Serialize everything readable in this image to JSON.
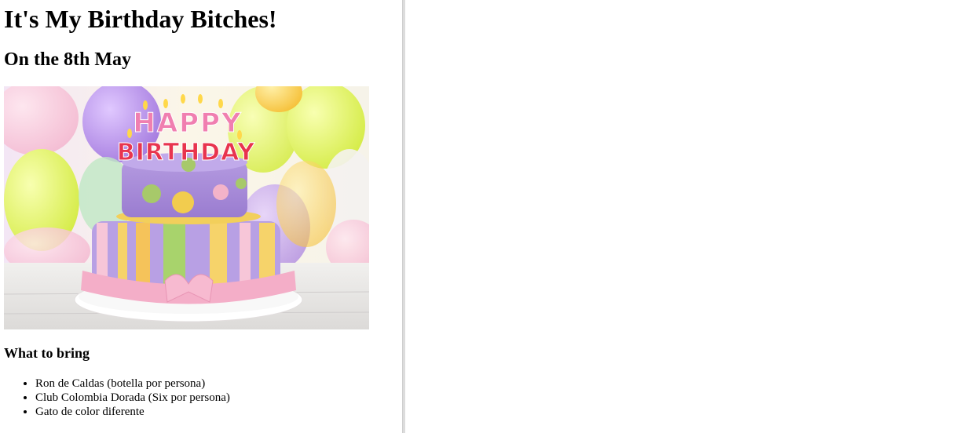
{
  "page": {
    "title": "It's My Birthday Bitches!",
    "date": "On the 8th May",
    "image": {
      "alt": "Happy Birthday cake",
      "cake_text_top": "HAPPY",
      "cake_text_bottom": "BIRTHDAY"
    },
    "bring_heading": "What to bring",
    "bring_items": [
      "Ron de Caldas (botella por persona)",
      "Club Colombia Dorada (Six por persona)",
      "Gato de color diferente"
    ]
  },
  "colors": {
    "background": "#ffffff",
    "divider": "#dcdcdc",
    "text": "#000000"
  }
}
